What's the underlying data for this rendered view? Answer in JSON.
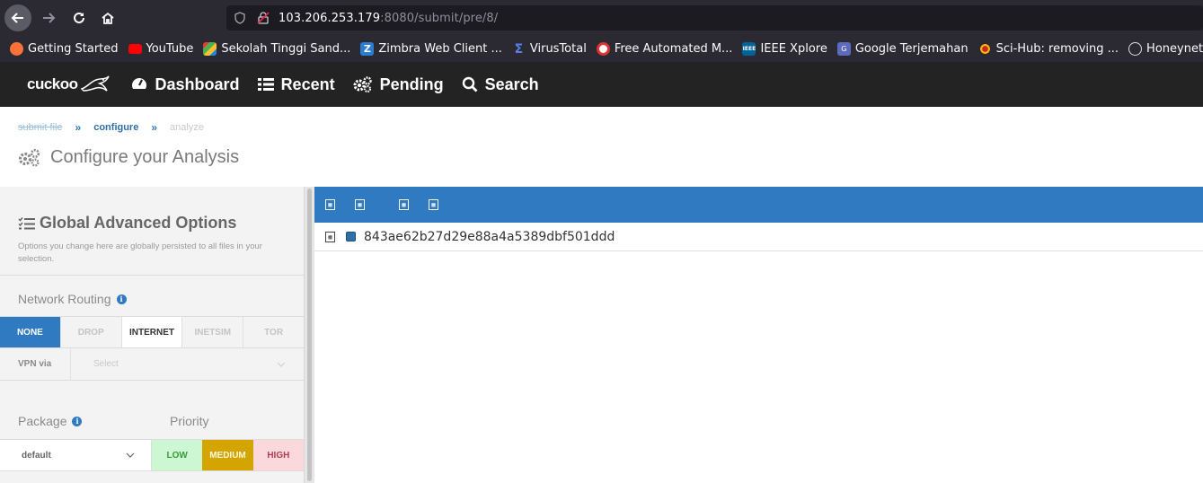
{
  "browser": {
    "url_host": "103.206.253.179",
    "url_rest": ":8080/submit/pre/8/"
  },
  "bookmarks": [
    {
      "label": "Getting Started",
      "icon": "firefox-icon",
      "color": "#ff7139"
    },
    {
      "label": "YouTube",
      "icon": "youtube-icon",
      "color": "#ff0000"
    },
    {
      "label": "Sekolah Tinggi Sand...",
      "icon": "sts-icon",
      "color": "#4caf50"
    },
    {
      "label": "Zimbra Web Client ...",
      "icon": "zimbra-icon",
      "color": "#2c7cd1"
    },
    {
      "label": "VirusTotal",
      "icon": "virustotal-icon",
      "color": "#3c5bd6"
    },
    {
      "label": "Free Automated M...",
      "icon": "malware-icon",
      "color": "#d33"
    },
    {
      "label": "IEEE Xplore",
      "icon": "ieee-icon",
      "color": "#00629b"
    },
    {
      "label": "Google Terjemahan",
      "icon": "translate-icon",
      "color": "#5c6bc0"
    },
    {
      "label": "Sci-Hub: removing ...",
      "icon": "scihub-icon",
      "color": "#e65100"
    },
    {
      "label": "Honeynet Map | BS...",
      "icon": "globe-icon",
      "color": "#cccccc"
    }
  ],
  "nav": {
    "logo": "cuckoo",
    "items": [
      "Dashboard",
      "Recent",
      "Pending",
      "Search"
    ]
  },
  "breadcrumb": {
    "step1": "submit file",
    "step2": "configure",
    "step3": "analyze",
    "sep": "»"
  },
  "page_title": "Configure your Analysis",
  "options": {
    "title": "Global Advanced Options",
    "description": "Options you change here are globally persisted to all files in your selection.",
    "routing_label": "Network Routing",
    "routing": [
      "NONE",
      "DROP",
      "INTERNET",
      "INETSIM",
      "TOR"
    ],
    "vpn_label": "VPN via",
    "vpn_placeholder": "Select",
    "package_label": "Package",
    "package_value": "default",
    "priority_label": "Priority",
    "priorities": [
      "LOW",
      "MEDIUM",
      "HIGH"
    ]
  },
  "files": [
    {
      "name": "843ae62b27d29e88a4a5389dbf501ddd"
    }
  ],
  "colors": {
    "accent": "#2f7ac0",
    "navbar": "#232323"
  }
}
